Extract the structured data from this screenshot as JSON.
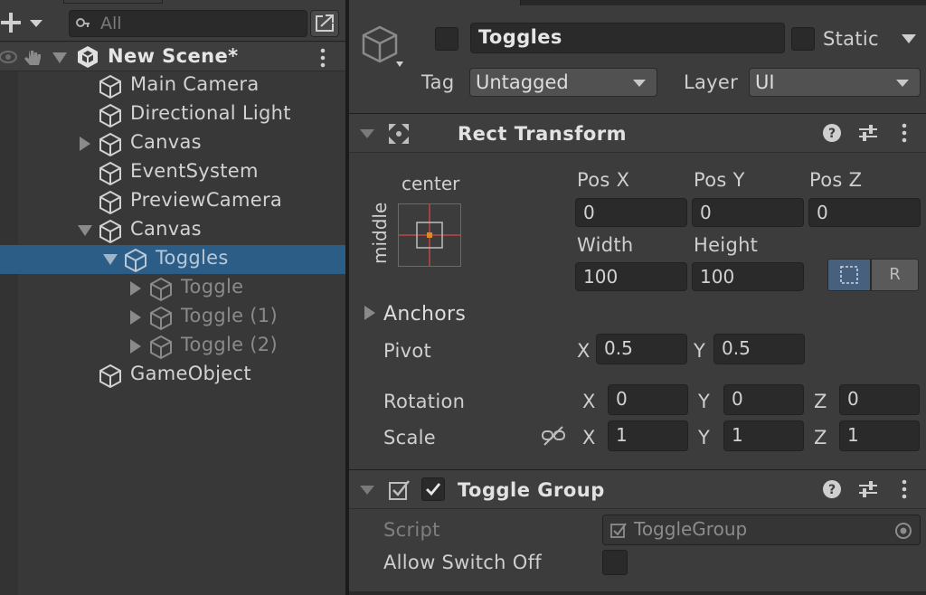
{
  "hierarchy": {
    "search": {
      "placeholder": "All"
    },
    "scene_name": "New Scene*",
    "items": [
      {
        "label": "Main Camera",
        "state": "normal"
      },
      {
        "label": "Directional Light",
        "state": "normal"
      },
      {
        "label": "Canvas",
        "state": "normal"
      },
      {
        "label": "EventSystem",
        "state": "normal"
      },
      {
        "label": "PreviewCamera",
        "state": "normal"
      },
      {
        "label": "Canvas",
        "state": "normal"
      },
      {
        "label": "Toggles",
        "state": "selected"
      },
      {
        "label": "Toggle",
        "state": "dim"
      },
      {
        "label": "Toggle (1)",
        "state": "dim"
      },
      {
        "label": "Toggle (2)",
        "state": "dim"
      },
      {
        "label": "GameObject",
        "state": "normal"
      }
    ]
  },
  "inspector": {
    "object_name": "Toggles",
    "static_label": "Static",
    "tag_label": "Tag",
    "tag_value": "Untagged",
    "layer_label": "Layer",
    "layer_value": "UI",
    "rect_transform": {
      "title": "Rect Transform",
      "anchor_h": "center",
      "anchor_v": "middle",
      "pos_x_label": "Pos X",
      "pos_y_label": "Pos Y",
      "pos_z_label": "Pos Z",
      "pos_x": "0",
      "pos_y": "0",
      "pos_z": "0",
      "width_label": "Width",
      "height_label": "Height",
      "width": "100",
      "height": "100",
      "raw_edit_glyph": "R",
      "anchors_label": "Anchors",
      "pivot_label": "Pivot",
      "pivot_x_label": "X",
      "pivot_x": "0.5",
      "pivot_y_label": "Y",
      "pivot_y": "0.5",
      "rotation_label": "Rotation",
      "rot_x_label": "X",
      "rot_x": "0",
      "rot_y_label": "Y",
      "rot_y": "0",
      "rot_z_label": "Z",
      "rot_z": "0",
      "scale_label": "Scale",
      "scale_x_label": "X",
      "scale_x": "1",
      "scale_y_label": "Y",
      "scale_y": "1",
      "scale_z_label": "Z",
      "scale_z": "1"
    },
    "toggle_group": {
      "title": "Toggle Group",
      "script_label": "Script",
      "script_value": "ToggleGroup",
      "allow_switch_off_label": "Allow Switch Off"
    }
  },
  "colors": {
    "selection": "#2c5d87",
    "anchor_orange": "#e08a1e",
    "anchor_red": "#c24444"
  }
}
